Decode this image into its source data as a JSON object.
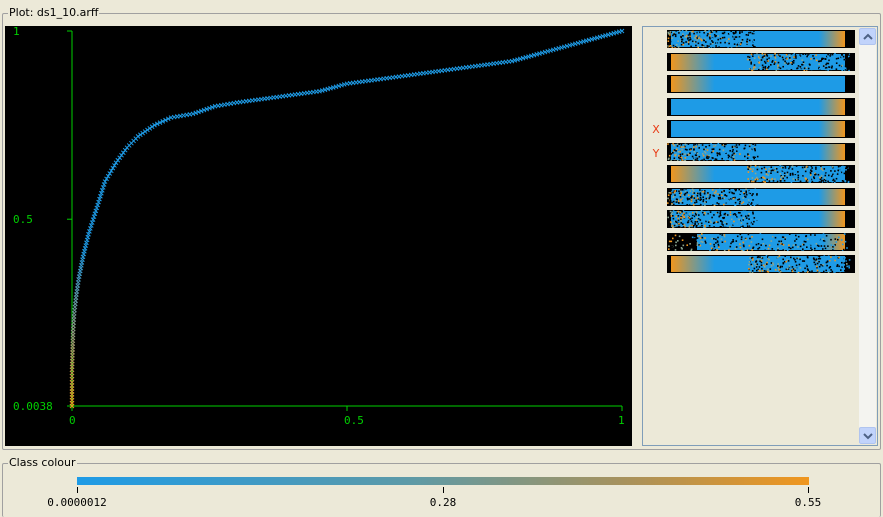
{
  "plot_group": {
    "title": "Plot: ds1_10.arff"
  },
  "class_group": {
    "title": "Class colour"
  },
  "colors": {
    "background": "#000000",
    "axis": "#00d000",
    "low": "#1e9be6",
    "high": "#f0961e",
    "marker_label": "#e83a14"
  },
  "chart_data": {
    "type": "scatter",
    "title": "",
    "xlabel": "",
    "ylabel": "",
    "xlim": [
      0,
      1
    ],
    "ylim": [
      0.0038,
      1
    ],
    "x_ticks": [
      "0",
      "0.5",
      "1"
    ],
    "y_ticks": [
      "0.0038",
      "0.5",
      "1"
    ],
    "x": [
      0,
      0,
      0,
      0.002,
      0.004,
      0.008,
      0.012,
      0.02,
      0.03,
      0.045,
      0.06,
      0.08,
      0.1,
      0.12,
      0.15,
      0.18,
      0.22,
      0.26,
      0.3,
      0.35,
      0.4,
      0.45,
      0.5,
      0.55,
      0.6,
      0.65,
      0.7,
      0.75,
      0.8,
      0.85,
      0.9,
      0.95,
      1
    ],
    "y": [
      0.0038,
      0.05,
      0.1,
      0.2,
      0.25,
      0.3,
      0.34,
      0.4,
      0.46,
      0.53,
      0.6,
      0.65,
      0.69,
      0.72,
      0.75,
      0.77,
      0.78,
      0.8,
      0.81,
      0.82,
      0.83,
      0.84,
      0.86,
      0.87,
      0.88,
      0.89,
      0.9,
      0.91,
      0.92,
      0.94,
      0.96,
      0.98,
      1.0
    ],
    "colour_scale": {
      "min_label": "0.0000012",
      "mid_label": "0.28",
      "max_label": "0.55"
    }
  },
  "side_panel": {
    "x_marker": "X",
    "y_marker": "Y",
    "strips": [
      {
        "id": "s1",
        "pattern": "speckle-left"
      },
      {
        "id": "s2",
        "pattern": "speckle-right"
      },
      {
        "id": "s3",
        "pattern": "solid-edge"
      },
      {
        "id": "s4",
        "pattern": "solid"
      },
      {
        "id": "s5",
        "pattern": "solid-left"
      },
      {
        "id": "s6",
        "pattern": "speckle-left"
      },
      {
        "id": "s7",
        "pattern": "speckle-right"
      },
      {
        "id": "s8",
        "pattern": "speckle-left"
      },
      {
        "id": "s9",
        "pattern": "speckle-left"
      },
      {
        "id": "s10",
        "pattern": "speckle-mid"
      },
      {
        "id": "s11",
        "pattern": "speckle-right"
      }
    ]
  },
  "scrollbar": {
    "up_icon": "chevron-up-icon",
    "down_icon": "chevron-down-icon"
  }
}
